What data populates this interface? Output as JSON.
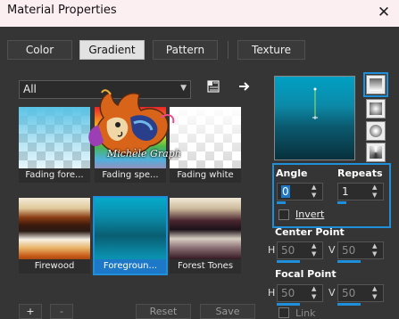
{
  "window": {
    "title": "Material Properties",
    "close_glyph": "✕"
  },
  "tabs": [
    {
      "label": "Color"
    },
    {
      "label": "Gradient"
    },
    {
      "label": "Pattern"
    },
    {
      "label": "Texture"
    }
  ],
  "filter": {
    "selected": "All"
  },
  "gradients": [
    {
      "label": "Fading fore..."
    },
    {
      "label": "Fading spe..."
    },
    {
      "label": "Fading white"
    },
    {
      "label": "Firewood"
    },
    {
      "label": "Foregroun..."
    },
    {
      "label": "Forest Tones"
    }
  ],
  "watermark": {
    "text": "Michèle Graph"
  },
  "angle": {
    "label": "Angle",
    "value": "0"
  },
  "repeats": {
    "label": "Repeats",
    "value": "1"
  },
  "invert": {
    "label": "Invert",
    "checked": false
  },
  "center_point": {
    "label": "Center Point",
    "h_label": "H",
    "h_value": "50",
    "v_label": "V",
    "v_value": "50"
  },
  "focal_point": {
    "label": "Focal Point",
    "h_label": "H",
    "h_value": "50",
    "v_label": "V",
    "v_value": "50",
    "link_label": "Link"
  },
  "footer": {
    "add_label": "+",
    "remove_label": "-",
    "reset_label": "Reset",
    "save_label": "Save"
  },
  "colors": {
    "accent": "#1e8fd8",
    "selected_label_bg": "#1e78c8",
    "panel_bg": "#353535"
  }
}
